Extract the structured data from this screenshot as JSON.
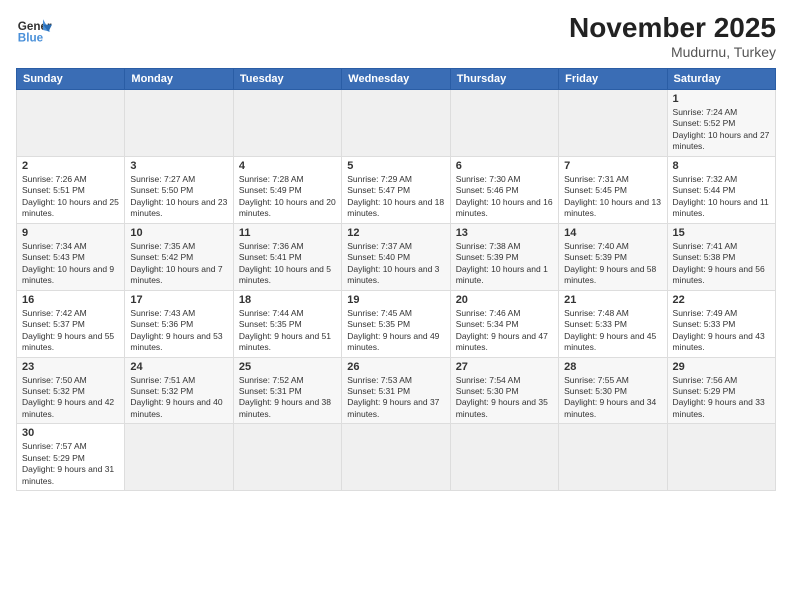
{
  "header": {
    "logo_general": "General",
    "logo_blue": "Blue",
    "title": "November 2025",
    "subtitle": "Mudurnu, Turkey"
  },
  "weekdays": [
    "Sunday",
    "Monday",
    "Tuesday",
    "Wednesday",
    "Thursday",
    "Friday",
    "Saturday"
  ],
  "weeks": [
    [
      {
        "day": "",
        "empty": true
      },
      {
        "day": "",
        "empty": true
      },
      {
        "day": "",
        "empty": true
      },
      {
        "day": "",
        "empty": true
      },
      {
        "day": "",
        "empty": true
      },
      {
        "day": "",
        "empty": true
      },
      {
        "day": "1",
        "sunrise": "Sunrise: 7:24 AM",
        "sunset": "Sunset: 5:52 PM",
        "daylight": "Daylight: 10 hours and 27 minutes."
      }
    ],
    [
      {
        "day": "2",
        "sunrise": "Sunrise: 7:26 AM",
        "sunset": "Sunset: 5:51 PM",
        "daylight": "Daylight: 10 hours and 25 minutes."
      },
      {
        "day": "3",
        "sunrise": "Sunrise: 7:27 AM",
        "sunset": "Sunset: 5:50 PM",
        "daylight": "Daylight: 10 hours and 23 minutes."
      },
      {
        "day": "4",
        "sunrise": "Sunrise: 7:28 AM",
        "sunset": "Sunset: 5:49 PM",
        "daylight": "Daylight: 10 hours and 20 minutes."
      },
      {
        "day": "5",
        "sunrise": "Sunrise: 7:29 AM",
        "sunset": "Sunset: 5:47 PM",
        "daylight": "Daylight: 10 hours and 18 minutes."
      },
      {
        "day": "6",
        "sunrise": "Sunrise: 7:30 AM",
        "sunset": "Sunset: 5:46 PM",
        "daylight": "Daylight: 10 hours and 16 minutes."
      },
      {
        "day": "7",
        "sunrise": "Sunrise: 7:31 AM",
        "sunset": "Sunset: 5:45 PM",
        "daylight": "Daylight: 10 hours and 13 minutes."
      },
      {
        "day": "8",
        "sunrise": "Sunrise: 7:32 AM",
        "sunset": "Sunset: 5:44 PM",
        "daylight": "Daylight: 10 hours and 11 minutes."
      }
    ],
    [
      {
        "day": "9",
        "sunrise": "Sunrise: 7:34 AM",
        "sunset": "Sunset: 5:43 PM",
        "daylight": "Daylight: 10 hours and 9 minutes."
      },
      {
        "day": "10",
        "sunrise": "Sunrise: 7:35 AM",
        "sunset": "Sunset: 5:42 PM",
        "daylight": "Daylight: 10 hours and 7 minutes."
      },
      {
        "day": "11",
        "sunrise": "Sunrise: 7:36 AM",
        "sunset": "Sunset: 5:41 PM",
        "daylight": "Daylight: 10 hours and 5 minutes."
      },
      {
        "day": "12",
        "sunrise": "Sunrise: 7:37 AM",
        "sunset": "Sunset: 5:40 PM",
        "daylight": "Daylight: 10 hours and 3 minutes."
      },
      {
        "day": "13",
        "sunrise": "Sunrise: 7:38 AM",
        "sunset": "Sunset: 5:39 PM",
        "daylight": "Daylight: 10 hours and 1 minute."
      },
      {
        "day": "14",
        "sunrise": "Sunrise: 7:40 AM",
        "sunset": "Sunset: 5:39 PM",
        "daylight": "Daylight: 9 hours and 58 minutes."
      },
      {
        "day": "15",
        "sunrise": "Sunrise: 7:41 AM",
        "sunset": "Sunset: 5:38 PM",
        "daylight": "Daylight: 9 hours and 56 minutes."
      }
    ],
    [
      {
        "day": "16",
        "sunrise": "Sunrise: 7:42 AM",
        "sunset": "Sunset: 5:37 PM",
        "daylight": "Daylight: 9 hours and 55 minutes."
      },
      {
        "day": "17",
        "sunrise": "Sunrise: 7:43 AM",
        "sunset": "Sunset: 5:36 PM",
        "daylight": "Daylight: 9 hours and 53 minutes."
      },
      {
        "day": "18",
        "sunrise": "Sunrise: 7:44 AM",
        "sunset": "Sunset: 5:35 PM",
        "daylight": "Daylight: 9 hours and 51 minutes."
      },
      {
        "day": "19",
        "sunrise": "Sunrise: 7:45 AM",
        "sunset": "Sunset: 5:35 PM",
        "daylight": "Daylight: 9 hours and 49 minutes."
      },
      {
        "day": "20",
        "sunrise": "Sunrise: 7:46 AM",
        "sunset": "Sunset: 5:34 PM",
        "daylight": "Daylight: 9 hours and 47 minutes."
      },
      {
        "day": "21",
        "sunrise": "Sunrise: 7:48 AM",
        "sunset": "Sunset: 5:33 PM",
        "daylight": "Daylight: 9 hours and 45 minutes."
      },
      {
        "day": "22",
        "sunrise": "Sunrise: 7:49 AM",
        "sunset": "Sunset: 5:33 PM",
        "daylight": "Daylight: 9 hours and 43 minutes."
      }
    ],
    [
      {
        "day": "23",
        "sunrise": "Sunrise: 7:50 AM",
        "sunset": "Sunset: 5:32 PM",
        "daylight": "Daylight: 9 hours and 42 minutes."
      },
      {
        "day": "24",
        "sunrise": "Sunrise: 7:51 AM",
        "sunset": "Sunset: 5:32 PM",
        "daylight": "Daylight: 9 hours and 40 minutes."
      },
      {
        "day": "25",
        "sunrise": "Sunrise: 7:52 AM",
        "sunset": "Sunset: 5:31 PM",
        "daylight": "Daylight: 9 hours and 38 minutes."
      },
      {
        "day": "26",
        "sunrise": "Sunrise: 7:53 AM",
        "sunset": "Sunset: 5:31 PM",
        "daylight": "Daylight: 9 hours and 37 minutes."
      },
      {
        "day": "27",
        "sunrise": "Sunrise: 7:54 AM",
        "sunset": "Sunset: 5:30 PM",
        "daylight": "Daylight: 9 hours and 35 minutes."
      },
      {
        "day": "28",
        "sunrise": "Sunrise: 7:55 AM",
        "sunset": "Sunset: 5:30 PM",
        "daylight": "Daylight: 9 hours and 34 minutes."
      },
      {
        "day": "29",
        "sunrise": "Sunrise: 7:56 AM",
        "sunset": "Sunset: 5:29 PM",
        "daylight": "Daylight: 9 hours and 33 minutes."
      }
    ],
    [
      {
        "day": "30",
        "sunrise": "Sunrise: 7:57 AM",
        "sunset": "Sunset: 5:29 PM",
        "daylight": "Daylight: 9 hours and 31 minutes."
      },
      {
        "day": "",
        "empty": true
      },
      {
        "day": "",
        "empty": true
      },
      {
        "day": "",
        "empty": true
      },
      {
        "day": "",
        "empty": true
      },
      {
        "day": "",
        "empty": true
      },
      {
        "day": "",
        "empty": true
      }
    ]
  ]
}
